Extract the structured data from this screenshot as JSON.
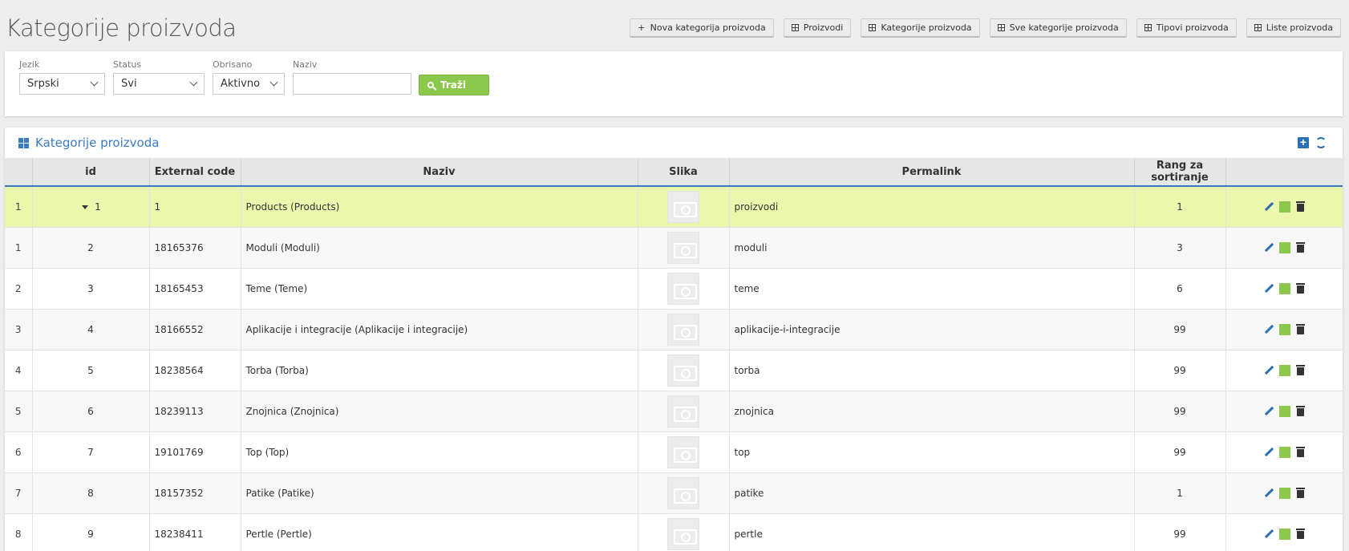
{
  "page_title": "Kategorije proizvoda",
  "top_buttons": [
    {
      "label": "Nova kategorija proizvoda",
      "icon": "plus-icon"
    },
    {
      "label": "Proizvodi",
      "icon": "grid-icon"
    },
    {
      "label": "Kategorije proizvoda",
      "icon": "grid-icon"
    },
    {
      "label": "Sve kategorije proizvoda",
      "icon": "grid-icon"
    },
    {
      "label": "Tipovi proizvoda",
      "icon": "grid-icon"
    },
    {
      "label": "Liste proizvoda",
      "icon": "grid-icon"
    }
  ],
  "filters": {
    "jezik": {
      "label": "Jezik",
      "value": "Srpski"
    },
    "status": {
      "label": "Status",
      "value": "Svi"
    },
    "obrisano": {
      "label": "Obrisano",
      "value": "Aktivno"
    },
    "naziv": {
      "label": "Naziv",
      "value": ""
    },
    "search_label": "Traži"
  },
  "table": {
    "title": "Kategorije proizvoda",
    "columns": [
      "",
      "id",
      "External code",
      "Naziv",
      "Slika",
      "Permalink",
      "Rang za sortiranje",
      ""
    ],
    "rows": [
      {
        "rn": "1",
        "id": "1",
        "code": "1",
        "naziv": "Products (Products)",
        "permalink": "proizvodi",
        "rank": "1",
        "selected": true
      },
      {
        "rn": "1",
        "id": "2",
        "code": "18165376",
        "naziv": "Moduli (Moduli)",
        "permalink": "moduli",
        "rank": "3"
      },
      {
        "rn": "2",
        "id": "3",
        "code": "18165453",
        "naziv": "Teme (Teme)",
        "permalink": "teme",
        "rank": "6"
      },
      {
        "rn": "3",
        "id": "4",
        "code": "18166552",
        "naziv": "Aplikacije i integracije (Aplikacije i integracije)",
        "permalink": "aplikacije-i-integracije",
        "rank": "99"
      },
      {
        "rn": "4",
        "id": "5",
        "code": "18238564",
        "naziv": "Torba (Torba)",
        "permalink": "torba",
        "rank": "99"
      },
      {
        "rn": "5",
        "id": "6",
        "code": "18239113",
        "naziv": "Znojnica (Znojnica)",
        "permalink": "znojnica",
        "rank": "99"
      },
      {
        "rn": "6",
        "id": "7",
        "code": "19101769",
        "naziv": "Top (Top)",
        "permalink": "top",
        "rank": "99"
      },
      {
        "rn": "7",
        "id": "8",
        "code": "18157352",
        "naziv": "Patike (Patike)",
        "permalink": "patike",
        "rank": "1"
      },
      {
        "rn": "8",
        "id": "9",
        "code": "18238411",
        "naziv": "Pertle (Pertle)",
        "permalink": "pertle",
        "rank": "99"
      }
    ]
  },
  "colors": {
    "accent": "#3a7bbf",
    "success": "#8cc84b",
    "selected_row": "#ebf7ad"
  }
}
